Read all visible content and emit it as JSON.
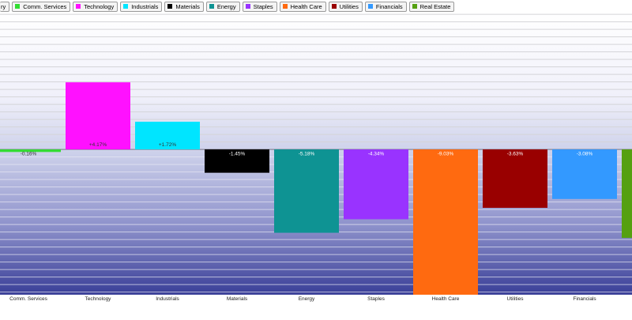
{
  "legend": [
    {
      "label": "ry",
      "color": ""
    },
    {
      "label": "Comm. Services",
      "color": "#33dd33"
    },
    {
      "label": "Technology",
      "color": "#ff11ff"
    },
    {
      "label": "Industrials",
      "color": "#00e5ff"
    },
    {
      "label": "Materials",
      "color": "#000000"
    },
    {
      "label": "Energy",
      "color": "#0e9393"
    },
    {
      "label": "Staples",
      "color": "#9933ff"
    },
    {
      "label": "Health Care",
      "color": "#ff6a10"
    },
    {
      "label": "Utilities",
      "color": "#990000"
    },
    {
      "label": "Financials",
      "color": "#3399ff"
    },
    {
      "label": "Real Estate",
      "color": "#55a011"
    }
  ],
  "chart_data": {
    "type": "bar",
    "categories": [
      "Comm. Services",
      "Technology",
      "Industrials",
      "Materials",
      "Energy",
      "Staples",
      "Health Care",
      "Utilities",
      "Financials",
      ""
    ],
    "values": [
      -0.16,
      4.17,
      1.72,
      -1.45,
      -5.18,
      -4.34,
      -9.03,
      -3.63,
      -3.08,
      -5.5
    ],
    "labels": [
      "-0.16%",
      "+4.17%",
      "+1.72%",
      "-1.45%",
      "-5.18%",
      "-4.34%",
      "-9.03%",
      "-3.63%",
      "-3.08%",
      ""
    ],
    "colors": [
      "#33dd33",
      "#ff11ff",
      "#00e5ff",
      "#000000",
      "#0e9393",
      "#9933ff",
      "#ff6a10",
      "#990000",
      "#3399ff",
      "#55a011"
    ],
    "ylim": [
      -9.03,
      8.5
    ],
    "grid": true,
    "legend_position": "top"
  }
}
